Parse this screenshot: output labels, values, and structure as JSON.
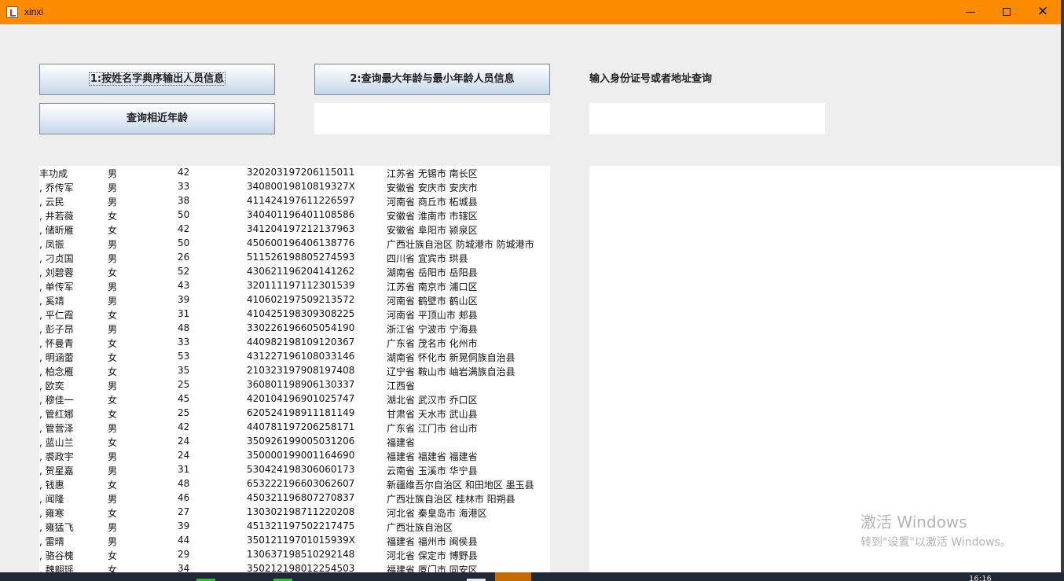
{
  "window": {
    "title": "xinxi"
  },
  "buttons": {
    "sort_by_name": "1:按姓名字典序输出人员信息",
    "max_min_age": "2:查询最大年龄与最小年龄人员信息",
    "similar_age": "查询相近年龄"
  },
  "query": {
    "label": "输入身份证号或者地址查询",
    "input_value": ""
  },
  "middle_output": {
    "value": ""
  },
  "people": [
    {
      "name": "丰功成",
      "gender": "男",
      "age": "42",
      "id": "320203197206115011",
      "address": "江苏省 无锡市 南长区"
    },
    {
      "name": ", 乔传军",
      "gender": "男",
      "age": "33",
      "id": "34080019810819327X",
      "address": "安徽省 安庆市 安庆市"
    },
    {
      "name": ", 云民",
      "gender": "男",
      "age": "38",
      "id": "411424197611226597",
      "address": "河南省 商丘市 柘城县"
    },
    {
      "name": ", 井若薇",
      "gender": "女",
      "age": "50",
      "id": "340401196401108586",
      "address": "安徽省 淮南市 市辖区"
    },
    {
      "name": ", 储昕雁",
      "gender": "女",
      "age": "42",
      "id": "341204197212137963",
      "address": "安徽省 阜阳市 颍泉区"
    },
    {
      "name": ", 凤振",
      "gender": "男",
      "age": "50",
      "id": "450600196406138776",
      "address": "广西壮族自治区 防城港市 防城港市"
    },
    {
      "name": ", 刁贞国",
      "gender": "男",
      "age": "26",
      "id": "511526198805274593",
      "address": "四川省 宜宾市 珙县"
    },
    {
      "name": ", 刘碧蓉",
      "gender": "女",
      "age": "52",
      "id": "430621196204141262",
      "address": "湖南省 岳阳市 岳阳县"
    },
    {
      "name": ", 单传军",
      "gender": "男",
      "age": "43",
      "id": "320111197112301539",
      "address": "江苏省 南京市 浦口区"
    },
    {
      "name": ", 奚靖",
      "gender": "男",
      "age": "39",
      "id": "410602197509213572",
      "address": "河南省 鹤壁市 鹤山区"
    },
    {
      "name": ", 平仁霞",
      "gender": "女",
      "age": "31",
      "id": "410425198309308225",
      "address": "河南省 平顶山市 郏县"
    },
    {
      "name": ", 彭子昂",
      "gender": "男",
      "age": "48",
      "id": "330226196605054190",
      "address": "浙江省 宁波市 宁海县"
    },
    {
      "name": ", 怀曼青",
      "gender": "女",
      "age": "33",
      "id": "440982198109120367",
      "address": "广东省 茂名市 化州市"
    },
    {
      "name": ", 明涵蕾",
      "gender": "女",
      "age": "53",
      "id": "431227196108033146",
      "address": "湖南省 怀化市 新晃侗族自治县"
    },
    {
      "name": ", 柏念雁",
      "gender": "女",
      "age": "35",
      "id": "210323197908197408",
      "address": "辽宁省 鞍山市 岫岩满族自治县"
    },
    {
      "name": ", 欧奕",
      "gender": "男",
      "age": "25",
      "id": "360801198906130337",
      "address": "江西省"
    },
    {
      "name": ", 穆佳一",
      "gender": "女",
      "age": "45",
      "id": "420104196901025747",
      "address": "湖北省 武汉市 乔口区"
    },
    {
      "name": ", 管红娜",
      "gender": "女",
      "age": "25",
      "id": "620524198911181149",
      "address": "甘肃省 天水市 武山县"
    },
    {
      "name": ", 管营泽",
      "gender": "男",
      "age": "42",
      "id": "440781197206258171",
      "address": "广东省 江门市 台山市"
    },
    {
      "name": ", 蓝山兰",
      "gender": "女",
      "age": "24",
      "id": "350926199005031206",
      "address": "福建省"
    },
    {
      "name": ", 裘政宇",
      "gender": "男",
      "age": "24",
      "id": "350000199001164690",
      "address": "福建省 福建省 福建省"
    },
    {
      "name": ", 贺星嘉",
      "gender": "男",
      "age": "31",
      "id": "530424198306060173",
      "address": "云南省 玉溪市 华宁县"
    },
    {
      "name": ", 钱惠",
      "gender": "女",
      "age": "48",
      "id": "653222196603062607",
      "address": "新疆维吾尔自治区 和田地区 墨玉县"
    },
    {
      "name": ", 闻隆",
      "gender": "男",
      "age": "46",
      "id": "450321196807270837",
      "address": "广西壮族自治区 桂林市 阳朔县"
    },
    {
      "name": ", 雍寒",
      "gender": "女",
      "age": "27",
      "id": "130302198711220208",
      "address": "河北省 秦皇岛市 海港区"
    },
    {
      "name": ", 雍猛飞",
      "gender": "男",
      "age": "39",
      "id": "451321197502217475",
      "address": "广西壮族自治区"
    },
    {
      "name": ", 雷晴",
      "gender": "男",
      "age": "44",
      "id": "35012119701015939X",
      "address": "福建省 福州市 闽侯县"
    },
    {
      "name": ", 骆谷槐",
      "gender": "女",
      "age": "29",
      "id": "130637198510292148",
      "address": "河北省 保定市 博野县"
    },
    {
      "name": ", 魏翱瑶",
      "gender": "女",
      "age": "34",
      "id": "350212198012254503",
      "address": "福建省 厦门市 同安区"
    }
  ],
  "watermark": {
    "line1": "激活 Windows",
    "line2": "转到\"设置\"以激活 Windows。"
  },
  "taskbar": {
    "clock": "16:16"
  },
  "colors": {
    "titlebar": "#ff8c00",
    "window_bg": "#eeeeee",
    "taskbar": "#1f2a36"
  }
}
